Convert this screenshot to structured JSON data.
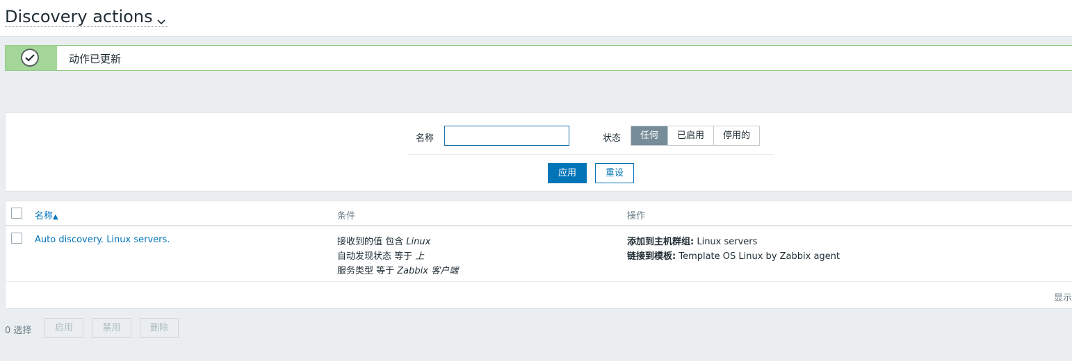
{
  "header": {
    "title": "Discovery actions"
  },
  "message": {
    "text": "动作已更新"
  },
  "filter": {
    "name_label": "名称",
    "name_value": "",
    "status_label": "状态",
    "status_options": [
      "任何",
      "已启用",
      "停用的"
    ],
    "status_selected": "任何",
    "apply_label": "应用",
    "reset_label": "重设"
  },
  "table": {
    "headers": {
      "name": "名称",
      "sort_indicator": "▲",
      "conditions": "条件",
      "operations": "操作"
    },
    "rows": [
      {
        "name": "Auto discovery. Linux servers.",
        "conditions": [
          {
            "label": "接收到的值 包含 ",
            "value": "Linux"
          },
          {
            "label": "自动发现状态 等于 ",
            "value": "上"
          },
          {
            "label": "服务类型 等于 ",
            "value": "Zabbix 客户端"
          }
        ],
        "operations": [
          {
            "label": "添加到主机群组:",
            "value": " Linux servers"
          },
          {
            "label": "链接到模板:",
            "value": " Template OS Linux by Zabbix agent"
          }
        ]
      }
    ],
    "display_text": "显示"
  },
  "footer": {
    "selected_count": "0 选择",
    "enable_label": "启用",
    "disable_label": "禁用",
    "delete_label": "删除"
  },
  "colors": {
    "accent": "#0275b8",
    "success": "#a4d69a",
    "selected_segment": "#768d99"
  }
}
